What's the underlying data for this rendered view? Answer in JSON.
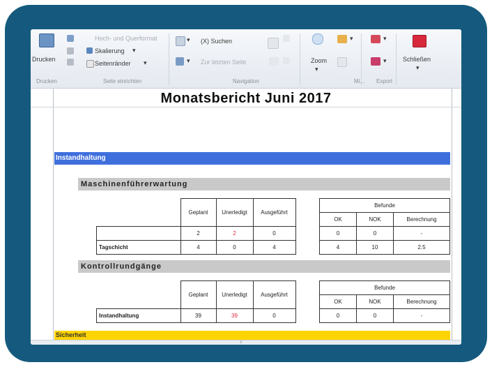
{
  "ribbon": {
    "print_label": "Drucken",
    "scaling_label": "Skalierung",
    "margins_label": "Seitenränder",
    "search_label": "(X) Suchen",
    "zoom_label": "Zoom",
    "close_label": "Schließen",
    "dim_top": "Hoch- und Querformat",
    "dim_nav": "Zur letzten Seite",
    "groups": {
      "print": "Drucken",
      "page_setup": "Seite einrichten",
      "navigation": "Navigation",
      "zoom_abbr": "Mi...",
      "export": "Export"
    }
  },
  "report": {
    "title": "Monatsbericht Juni 2017",
    "section": "Instandhaltung",
    "subsection1": "Maschinenführerwartung",
    "subsection2": "Kontrollrundgänge",
    "section2": "Sicherheit",
    "headers": {
      "geplant": "Geplant",
      "unerledigt": "Unerledigt",
      "ausgefuehrt": "Ausgeführt",
      "befunde": "Befunde",
      "ok": "OK",
      "nok": "NOK",
      "berechnung": "Berechnung"
    },
    "t1_rows": [
      {
        "label": "",
        "geplant": "2",
        "unerledigt": "2",
        "ausgefuehrt": "0",
        "ok": "0",
        "nok": "0",
        "berechnung": "-"
      },
      {
        "label": "Tagschicht",
        "geplant": "4",
        "unerledigt": "0",
        "ausgefuehrt": "4",
        "ok": "4",
        "nok": "10",
        "berechnung": "2.5"
      }
    ],
    "t2_rows": [
      {
        "label": "Instandhaltung",
        "geplant": "39",
        "unerledigt": "39",
        "ausgefuehrt": "0",
        "ok": "0",
        "nok": "0",
        "berechnung": "-"
      }
    ]
  }
}
